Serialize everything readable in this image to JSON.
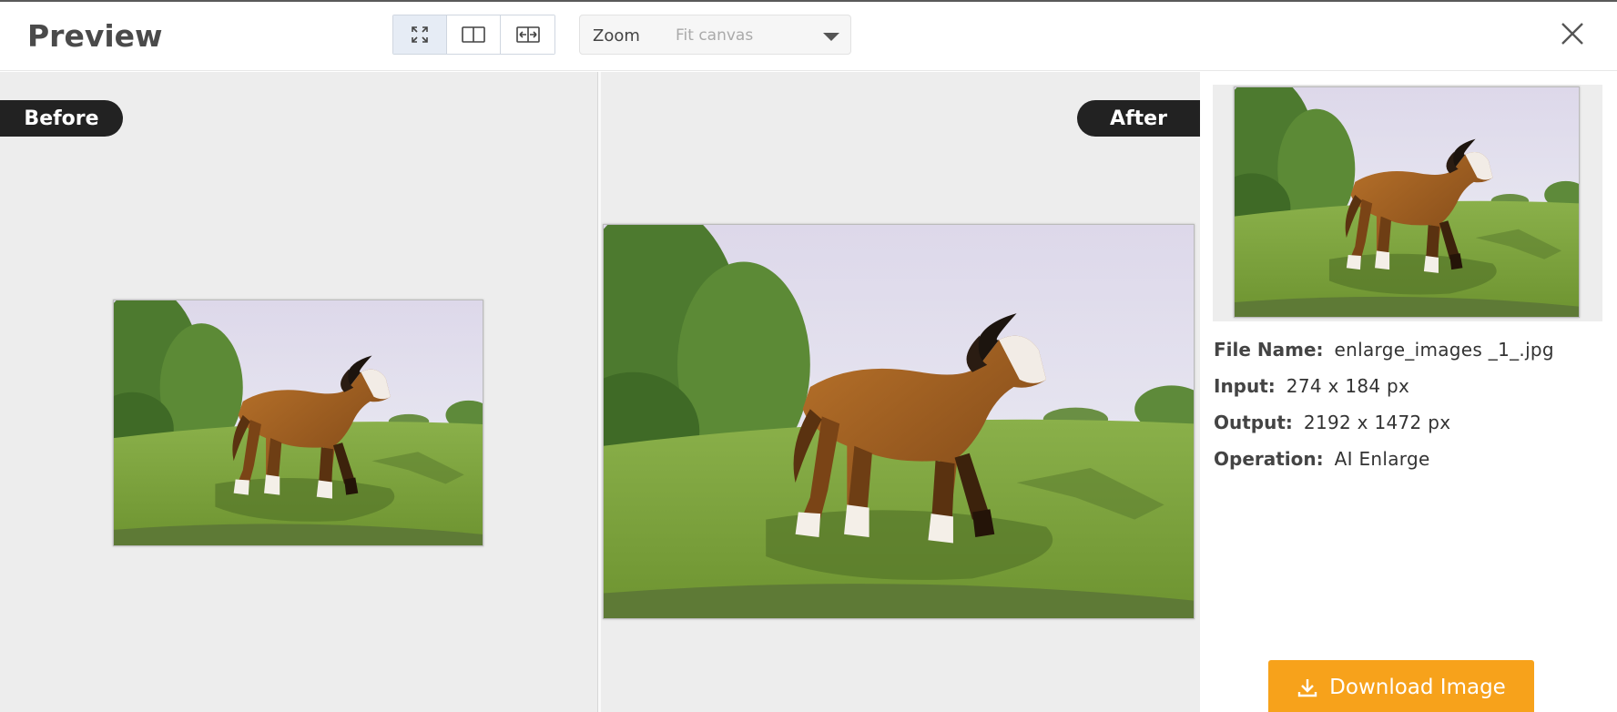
{
  "header": {
    "title": "Preview",
    "view_modes": [
      {
        "name": "fit-icon",
        "active": true
      },
      {
        "name": "split-view-icon",
        "active": false
      },
      {
        "name": "compare-slider-icon",
        "active": false
      }
    ],
    "zoom": {
      "label": "Zoom",
      "value": "Fit canvas"
    },
    "close_icon": "close-icon"
  },
  "panes": {
    "before_label": "Before",
    "after_label": "After"
  },
  "info": {
    "file_name_key": "File Name:",
    "file_name": "enlarge_images _1_.jpg",
    "input_key": "Input:",
    "input": "274 x 184 px",
    "output_key": "Output:",
    "output": "2192 x 1472 px",
    "operation_key": "Operation:",
    "operation": "AI Enlarge"
  },
  "download": {
    "label": "Download Image",
    "icon": "download-icon"
  },
  "colors": {
    "accent": "#f7a21b",
    "tag_bg": "#222222",
    "pane_bg": "#ededed",
    "active_view": "#e6ecf5"
  }
}
